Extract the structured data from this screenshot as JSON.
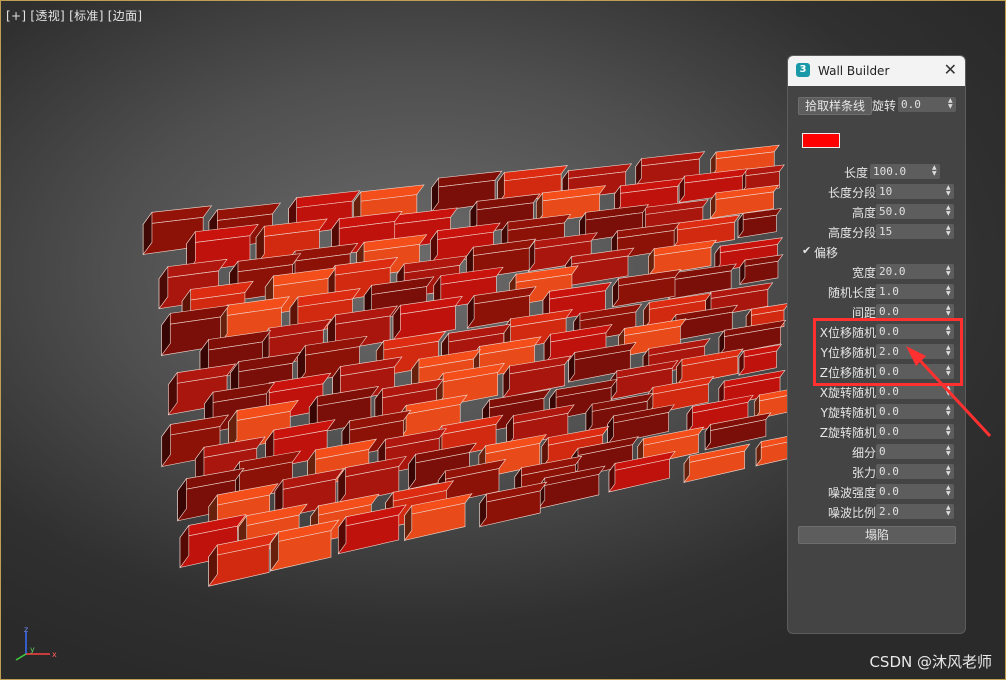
{
  "viewport": {
    "label": "[+] [透视] [标准] [边面]",
    "watermark": "CSDN @沐风老师",
    "gizmo": {
      "x": "x",
      "y": "y",
      "z": "z"
    }
  },
  "panel": {
    "title": "Wall Builder",
    "icon": "3",
    "close": "✕",
    "pick_spline": "拾取样条线",
    "rotate_label": "旋转",
    "rotate_value": "0.0",
    "swatch_color": "#ff0000",
    "offset_label": "偏移",
    "collapse": "塌陷",
    "params": [
      {
        "label": "长度",
        "value": "100.0",
        "wide": false
      },
      {
        "label": "长度分段",
        "value": "10",
        "wide": true
      },
      {
        "label": "高度",
        "value": "50.0",
        "wide": true
      },
      {
        "label": "高度分段",
        "value": "15",
        "wide": true
      },
      {
        "label": "宽度",
        "value": "20.0",
        "wide": true
      },
      {
        "label": "随机长度",
        "value": "1.0",
        "wide": true
      },
      {
        "label": "间距",
        "value": "0.0",
        "wide": true
      },
      {
        "label": "X位移随机",
        "value": "0.0",
        "wide": true
      },
      {
        "label": "Y位移随机",
        "value": "2.0",
        "wide": true
      },
      {
        "label": "Z位移随机",
        "value": "0.0",
        "wide": true
      },
      {
        "label": "X旋转随机",
        "value": "0.0",
        "wide": true
      },
      {
        "label": "Y旋转随机",
        "value": "0.0",
        "wide": true
      },
      {
        "label": "Z旋转随机",
        "value": "0.0",
        "wide": true
      },
      {
        "label": "细分",
        "value": "0",
        "wide": true
      },
      {
        "label": "张力",
        "value": "0.0",
        "wide": true
      },
      {
        "label": "噪波强度",
        "value": "0.0",
        "wide": true
      },
      {
        "label": "噪波比例",
        "value": "2.0",
        "wide": true
      }
    ]
  },
  "colors": {
    "highlight": "#ff3030",
    "brick_light": "#e84a1a",
    "brick_mid": "#c0120c",
    "brick_dark": "#7a0e08"
  }
}
